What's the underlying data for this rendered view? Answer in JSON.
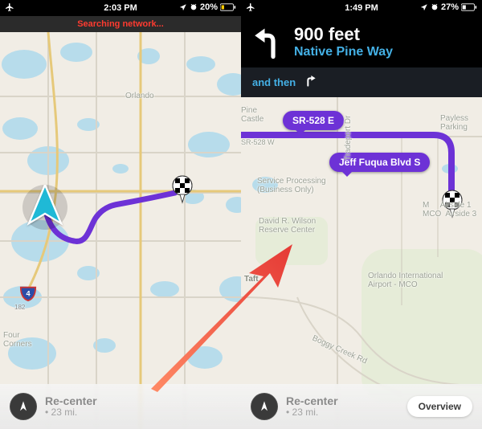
{
  "left": {
    "status": {
      "time": "2:03 PM",
      "battery": "20%"
    },
    "searching": "Searching network...",
    "map_labels": {
      "orlando": "Orlando",
      "four_corners": "Four\nCorners",
      "i4_shield": "4"
    },
    "bottom": {
      "recenter": "Re-center",
      "distance": "• 23 mi."
    }
  },
  "right": {
    "status": {
      "time": "1:49 PM",
      "battery": "27%"
    },
    "nav": {
      "distance": "900 feet",
      "road": "Native Pine Way",
      "and_then": "and then"
    },
    "route_pills": {
      "sr528": "SR-528 E",
      "jff": "Jeff Fuqua Blvd S"
    },
    "map_labels": {
      "pine_castle": "Pine\nCastle",
      "sr528w": "SR-528 W",
      "payless": "Payless\nParking",
      "service_processing": "Service Processing\n(Business Only)",
      "tradeport": "Tradeport Dr",
      "wilson": "David R. Wilson\nReserve Center",
      "airside": "M     Airside 1\nMCO  Airside 3",
      "oia": "Orlando International\nAirport - MCO",
      "taft": "Taft",
      "boggy": "Boggy Creek Rd"
    },
    "bottom": {
      "recenter": "Re-center",
      "distance": "• 23 mi.",
      "overview": "Overview"
    }
  }
}
